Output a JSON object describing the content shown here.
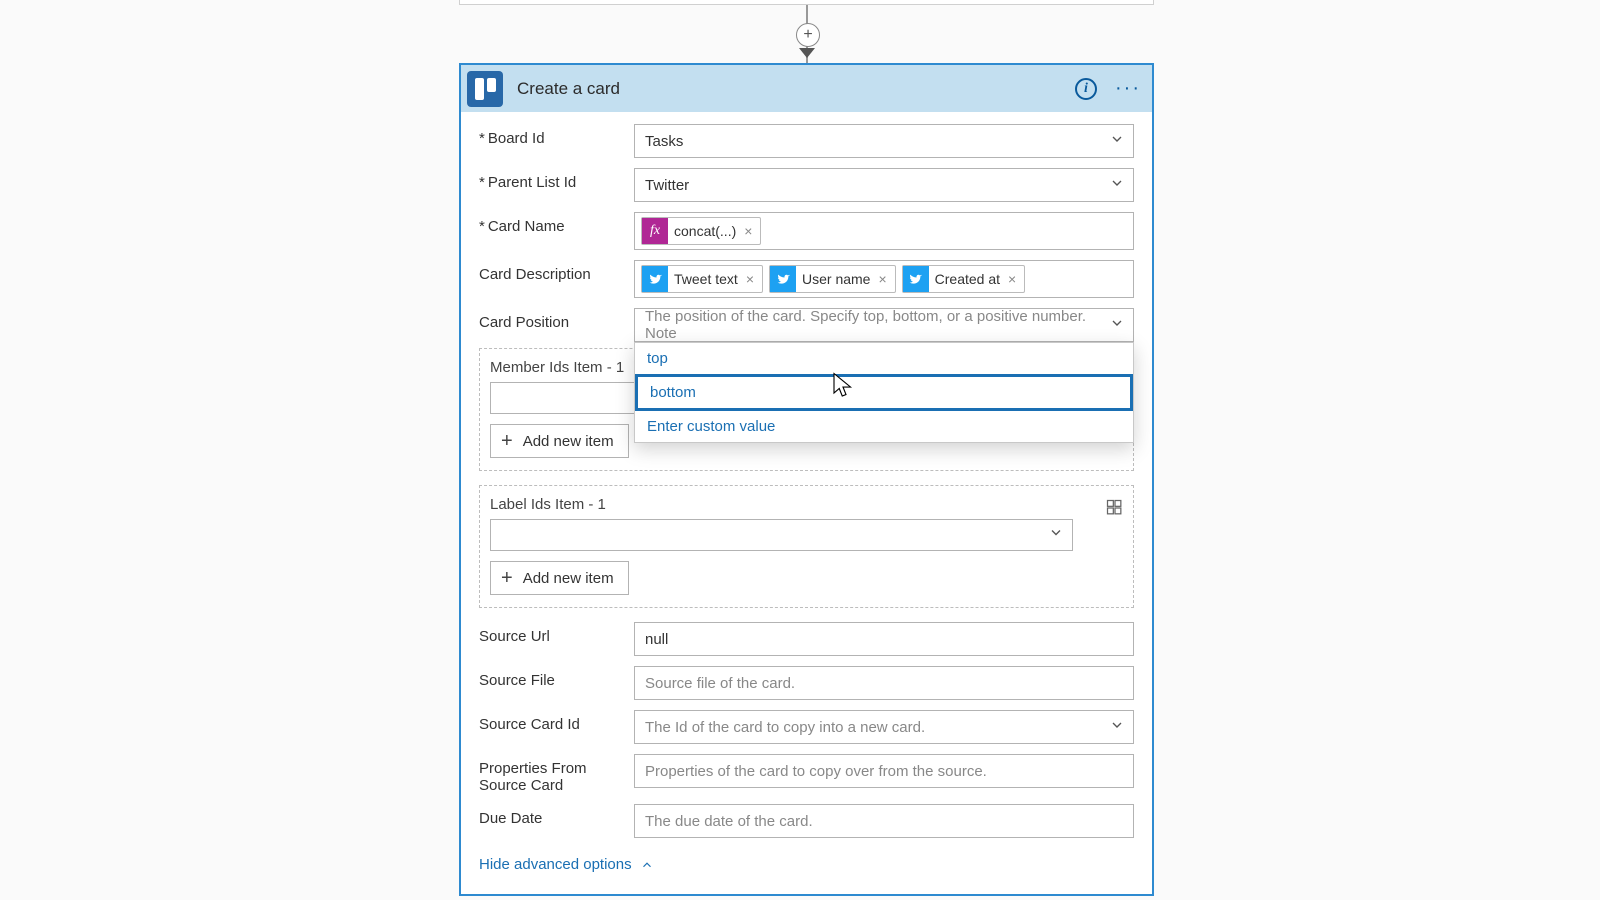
{
  "header": {
    "title": "Create a card"
  },
  "fields": {
    "boardId": {
      "label": "Board Id",
      "value": "Tasks"
    },
    "parentListId": {
      "label": "Parent List Id",
      "value": "Twitter"
    },
    "cardName": {
      "label": "Card Name",
      "tokens": [
        {
          "kind": "fx",
          "text": "concat(...)"
        }
      ]
    },
    "cardDescription": {
      "label": "Card Description",
      "tokens": [
        {
          "kind": "twitter",
          "text": "Tweet text"
        },
        {
          "kind": "twitter",
          "text": "User name"
        },
        {
          "kind": "twitter",
          "text": "Created at"
        }
      ]
    },
    "cardPosition": {
      "label": "Card Position",
      "placeholder": "The position of the card. Specify top, bottom, or a positive number. Note",
      "options": [
        "top",
        "bottom",
        "Enter custom value"
      ],
      "highlighted": "bottom"
    },
    "memberIds": {
      "label": "Member Ids Item - 1",
      "addLabel": "Add new item"
    },
    "labelIds": {
      "label": "Label Ids Item - 1",
      "addLabel": "Add new item"
    },
    "sourceUrl": {
      "label": "Source Url",
      "value": "null"
    },
    "sourceFile": {
      "label": "Source File",
      "placeholder": "Source file of the card."
    },
    "sourceCardId": {
      "label": "Source Card Id",
      "placeholder": "The Id of the card to copy into a new card."
    },
    "propsFromSource": {
      "label": "Properties From Source Card",
      "placeholder": "Properties of the card to copy over from the source."
    },
    "dueDate": {
      "label": "Due Date",
      "placeholder": "The due date of the card."
    }
  },
  "footer": {
    "hideAdvanced": "Hide advanced options"
  }
}
